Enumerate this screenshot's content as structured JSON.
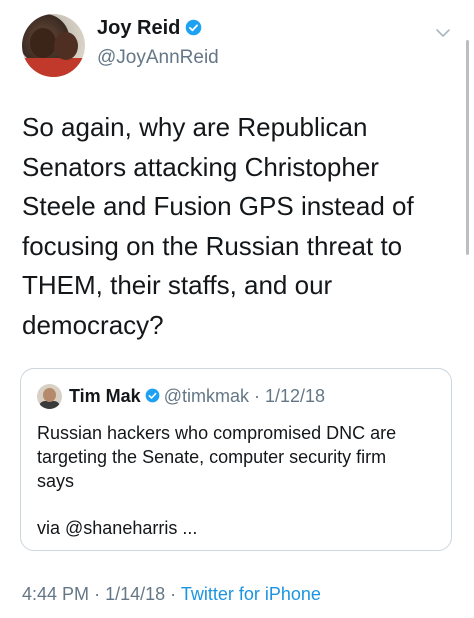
{
  "author": {
    "name": "Joy Reid",
    "handle": "@JoyAnnReid",
    "verified": true
  },
  "tweet": {
    "lines": [
      "So again, why are Republican",
      "Senators attacking Christopher",
      "Steele and Fusion GPS instead of",
      "focusing on the Russian threat to",
      "THEM, their staffs, and our",
      "democracy?"
    ]
  },
  "quoted_tweet": {
    "name": "Tim Mak",
    "handle": "@timkmak",
    "separator": "·",
    "date": "1/12/18",
    "verified": true,
    "text_lines": [
      "Russian hackers who compromised DNC are",
      "targeting the Senate, computer security firm",
      "says"
    ],
    "via": "via @shaneharris ..."
  },
  "meta": {
    "time": "4:44 PM",
    "sep1": "·",
    "date": "1/14/18",
    "sep2": "·",
    "source": "Twitter for iPhone"
  },
  "icons": {
    "verified": "verified-badge-icon",
    "caret": "chevron-down-icon"
  },
  "colors": {
    "text": "#14171a",
    "secondary": "#657786",
    "accent": "#1da1f2",
    "border": "#ccd6dd"
  }
}
